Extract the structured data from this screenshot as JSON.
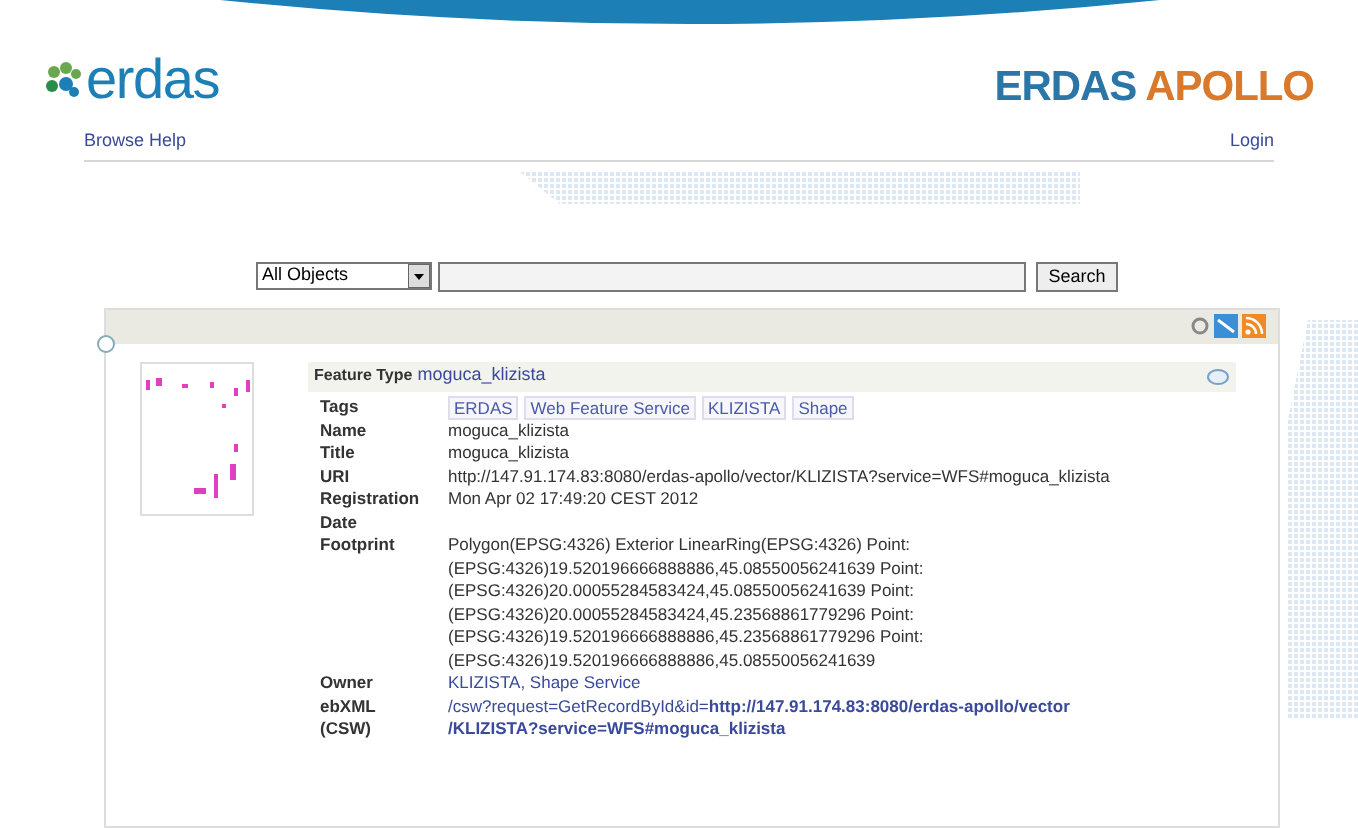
{
  "header": {
    "logo": "erdas",
    "product": [
      "ERDAS",
      "APOLLO"
    ]
  },
  "nav": {
    "left": "Browse Help",
    "right": "Login"
  },
  "search": {
    "scope": "All Objects",
    "button": "Search"
  },
  "record": {
    "title_label": "Feature Type",
    "title": "moguca_klizista",
    "fields": [
      {
        "kind": "tags",
        "label": [
          "Tags"
        ],
        "tags": [
          "ERDAS",
          "Web Feature Service",
          "KLIZISTA",
          "Shape"
        ]
      },
      {
        "kind": "text",
        "label": [
          "Name"
        ],
        "lines": [
          "moguca_klizista"
        ]
      },
      {
        "kind": "text",
        "label": [
          "Title"
        ],
        "lines": [
          "moguca_klizista"
        ]
      },
      {
        "kind": "text",
        "label": [
          "URI"
        ],
        "lines": [
          "http://147.91.174.83:8080/erdas-apollo/vector/KLIZISTA?service=WFS#moguca_klizista"
        ]
      },
      {
        "kind": "text",
        "label": [
          "Registration",
          "Date"
        ],
        "lines": [
          "Mon Apr 02 17:49:20 CEST 2012"
        ]
      },
      {
        "kind": "text",
        "label": [
          "Footprint"
        ],
        "lines": [
          "Polygon(EPSG:4326) Exterior LinearRing(EPSG:4326) Point:",
          "(EPSG:4326)19.520196666888886,45.08550056241639 Point:",
          "(EPSG:4326)20.00055284583424,45.08550056241639 Point:",
          "(EPSG:4326)20.00055284583424,45.23568861779296 Point:",
          "(EPSG:4326)19.520196666888886,45.23568861779296 Point:",
          "(EPSG:4326)19.520196666888886,45.08550056241639"
        ]
      },
      {
        "kind": "link",
        "label": [
          "Owner"
        ],
        "lines": [
          "KLIZISTA, Shape Service"
        ]
      },
      {
        "kind": "link",
        "label": [
          "ebXML",
          "(CSW)"
        ],
        "lines": [
          "/csw?request=GetRecordById&id=**http://147.91.174.83:8080/erdas-apollo/vector**",
          "**/KLIZISTA?service=WFS#moguca_klizista**"
        ]
      }
    ]
  }
}
